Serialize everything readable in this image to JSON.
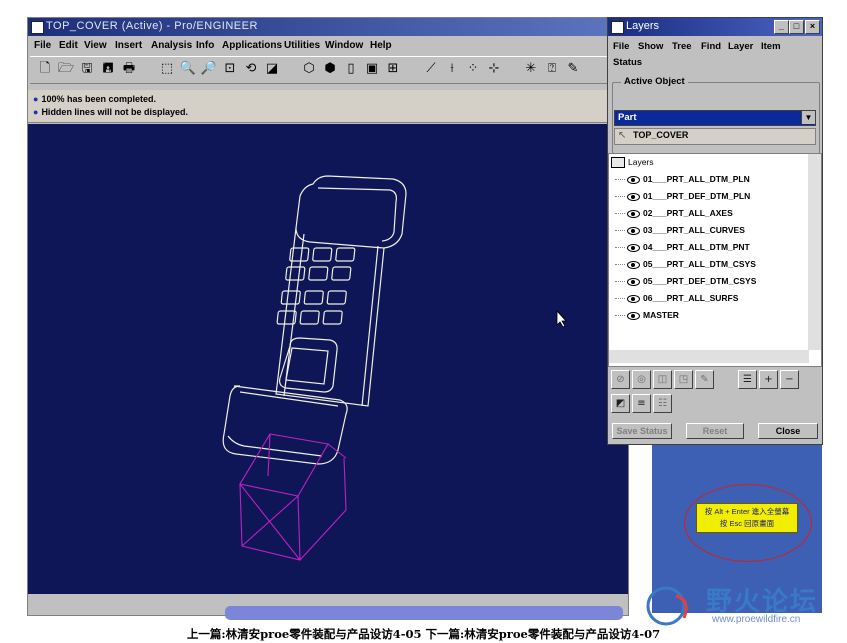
{
  "main_window": {
    "title": "TOP_COVER (Active) - Pro/ENGINEER",
    "menu": [
      "File",
      "Edit",
      "View",
      "Insert",
      "Analysis",
      "Info",
      "Applications",
      "Utilities",
      "Window",
      "Help"
    ],
    "messages": [
      "100% has been completed.",
      "Hidden lines will not be displayed."
    ]
  },
  "layers_dialog": {
    "title": "Layers",
    "menu": [
      "File",
      "Show",
      "Tree",
      "Find",
      "Layer",
      "Item"
    ],
    "status_label": "Status",
    "active_object_label": "Active Object",
    "part_select_value": "Part",
    "part_name": "TOP_COVER",
    "tree_root": "Layers",
    "layers": [
      "01___PRT_ALL_DTM_PLN",
      "01___PRT_DEF_DTM_PLN",
      "02___PRT_ALL_AXES",
      "03___PRT_ALL_CURVES",
      "04___PRT_ALL_DTM_PNT",
      "05___PRT_ALL_DTM_CSYS",
      "05___PRT_DEF_DTM_CSYS",
      "06___PRT_ALL_SURFS",
      "MASTER"
    ],
    "buttons": {
      "save_status": "Save Status",
      "reset": "Reset",
      "close": "Close"
    }
  },
  "hint_box": {
    "line1": "按 Alt + Enter 進入全螢幕",
    "line2": "按 Esc 回原畫面"
  },
  "watermark": {
    "name": "野火论坛",
    "url": "www.proewildfire.cn"
  },
  "caption": "上一篇:林清安proe零件装配与产品设访4-05 下一篇:林清安proe零件装配与产品设访4-07",
  "colors": {
    "viewport_bg": "#0e1658",
    "model_lines": "#f0f0e0",
    "magenta_lines": "#c020c0",
    "highlight_yellow": "#f2ee00"
  }
}
